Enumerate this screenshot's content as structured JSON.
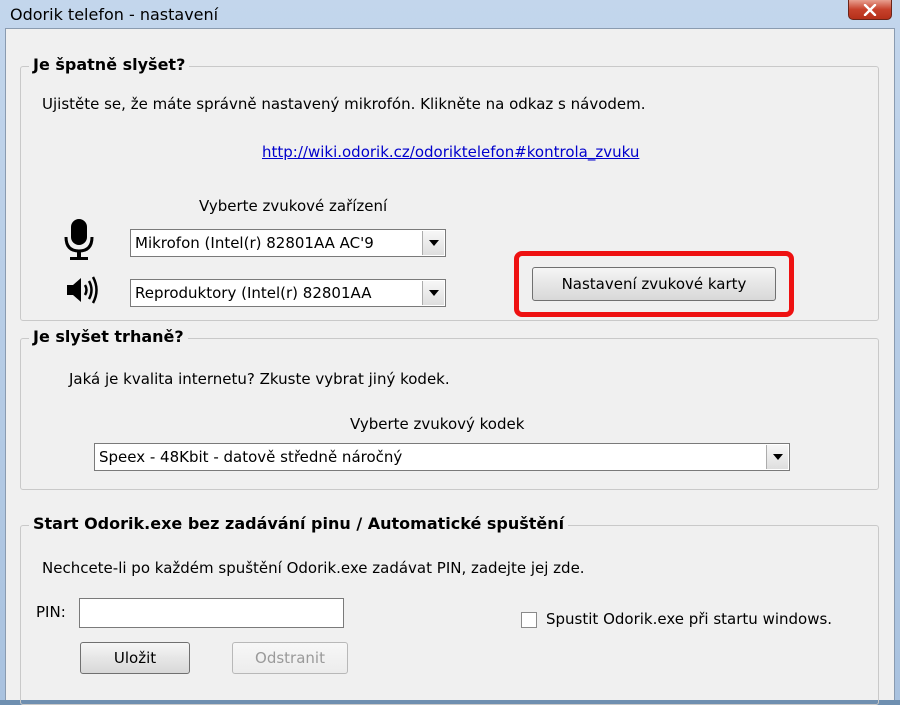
{
  "window": {
    "title": "Odorik telefon - nastavení"
  },
  "audio_group": {
    "title": "Je špatně slyšet?",
    "description": "Ujistěte se, že máte správně nastavený mikrofón. Klikněte na odkaz s návodem.",
    "help_link": "http://wiki.odorik.cz/odoriktelefon#kontrola_zvuku",
    "device_label": "Vyberte zvukové zařízení",
    "microphone_value": "Mikrofon (Intel(r) 82801AA AC'9",
    "speaker_value": "Reproduktory (Intel(r) 82801AA",
    "soundcard_button": "Nastavení zvukové karty"
  },
  "codec_group": {
    "title": "Je slyšet trhaně?",
    "description": "Jaká je kvalita internetu? Zkuste vybrat jiný kodek.",
    "codec_label": "Vyberte zvukový kodek",
    "codec_value": "Speex - 48Kbit - datově středně náročný"
  },
  "startup_group": {
    "title": "Start Odorik.exe bez zadávání pinu / Automatické spuštění",
    "description": "Nechcete-li po každém spuštění Odorik.exe zadávat PIN, zadejte jej zde.",
    "pin_label": "PIN:",
    "pin_value": "",
    "autostart_label": "Spustit Odorik.exe při startu windows.",
    "autostart_checked": false,
    "save_button": "Uložit",
    "remove_button": "Odstranit"
  },
  "colors": {
    "highlight": "#ee1111",
    "link": "#0000cc"
  }
}
